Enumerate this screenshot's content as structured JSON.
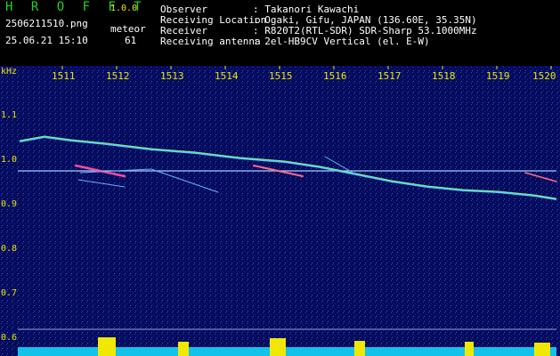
{
  "header": {
    "app_title": "H R O F F T",
    "version": "1.0.0",
    "filename": "2506211510.png",
    "datetime": "25.06.21 15:10",
    "meteor_label": "meteor",
    "meteor_count": "61",
    "info": [
      {
        "key": "Observer",
        "value": ": Takanori Kawachi"
      },
      {
        "key": "Receiving Location",
        "value": ": Ogaki, Gifu, JAPAN (136.60E, 35.35N)"
      },
      {
        "key": "Receiver",
        "value": ": R820T2(RTL-SDR) SDR-Sharp 53.1000MHz"
      },
      {
        "key": "Receiving antenna",
        "value": ": 2el-HB9CV Vertical (el. E-W)"
      }
    ]
  },
  "plot": {
    "y_unit": "kHz",
    "time_ticks": [
      "1511",
      "1512",
      "1513",
      "1514",
      "1515",
      "1516",
      "1517",
      "1518",
      "1519",
      "1520"
    ],
    "freq_ticks": [
      "1.1",
      "1.0",
      "0.9",
      "0.8",
      "0.7",
      "0.6"
    ],
    "colors": {
      "background": "#060b5a",
      "tick": "#e8e800",
      "trace": "#3aa0ff"
    }
  }
}
